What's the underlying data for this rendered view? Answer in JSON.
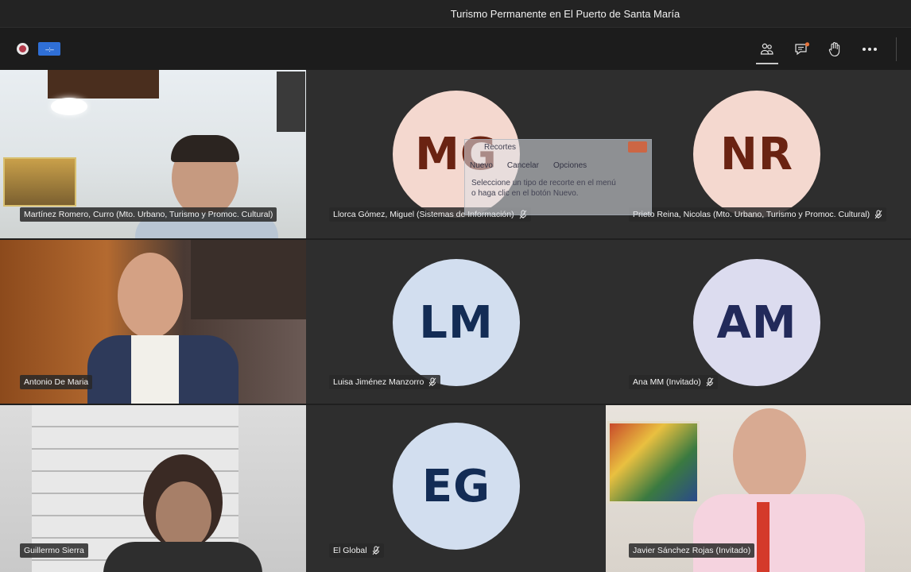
{
  "window": {
    "title": "Turismo Permanente en El Puerto de Santa María"
  },
  "toolbar": {
    "network_badge": "–:–",
    "buttons": [
      {
        "name": "participants-icon",
        "active": true
      },
      {
        "name": "chat-icon",
        "notification": true
      },
      {
        "name": "raise-hand-icon"
      },
      {
        "name": "more-icon"
      }
    ]
  },
  "tiles": [
    {
      "id": "t1",
      "name": "Martínez Romero, Curro (Mto. Urbano, Turismo y Promoc. Cultural)",
      "type": "video",
      "muted": false
    },
    {
      "id": "t2",
      "name": "Llorca Gómez, Miguel (Sistemas de Información)",
      "type": "avatar",
      "initials": "MG",
      "muted": true
    },
    {
      "id": "t3",
      "name": "Prieto Reina, Nicolas (Mto. Urbano, Turismo y Promoc. Cultural)",
      "type": "avatar",
      "initials": "NR",
      "muted": true
    },
    {
      "id": "t4",
      "name": "Antonio De Maria",
      "type": "video",
      "muted": false
    },
    {
      "id": "t5",
      "name": "Luisa Jiménez Manzorro",
      "type": "avatar",
      "initials": "LM",
      "muted": true
    },
    {
      "id": "t6",
      "name": "Ana MM (Invitado)",
      "type": "avatar",
      "initials": "AM",
      "muted": true
    },
    {
      "id": "t7",
      "name": "Guillermo Sierra",
      "type": "video",
      "muted": false
    },
    {
      "id": "t8",
      "name": "El Global",
      "type": "avatar",
      "initials": "EG",
      "muted": true
    },
    {
      "id": "t9",
      "name": "Javier Sánchez Rojas (Invitado)",
      "type": "video",
      "muted": false
    }
  ],
  "snipping_tool": {
    "title": "Recortes",
    "new_label": "Nuevo",
    "cancel_label": "Cancelar",
    "options_label": "Opciones",
    "help_text": "Seleccione un tipo de recorte en el menú o haga clic en el botón Nuevo."
  },
  "colors": {
    "background": "#1f1f1f",
    "tile_dark": "#2e2e2e",
    "avatar_pink": "#f4d8cf",
    "avatar_blue": "#d2deef",
    "avatar_lavender": "#dcdcef",
    "notification": "#e8743b"
  }
}
